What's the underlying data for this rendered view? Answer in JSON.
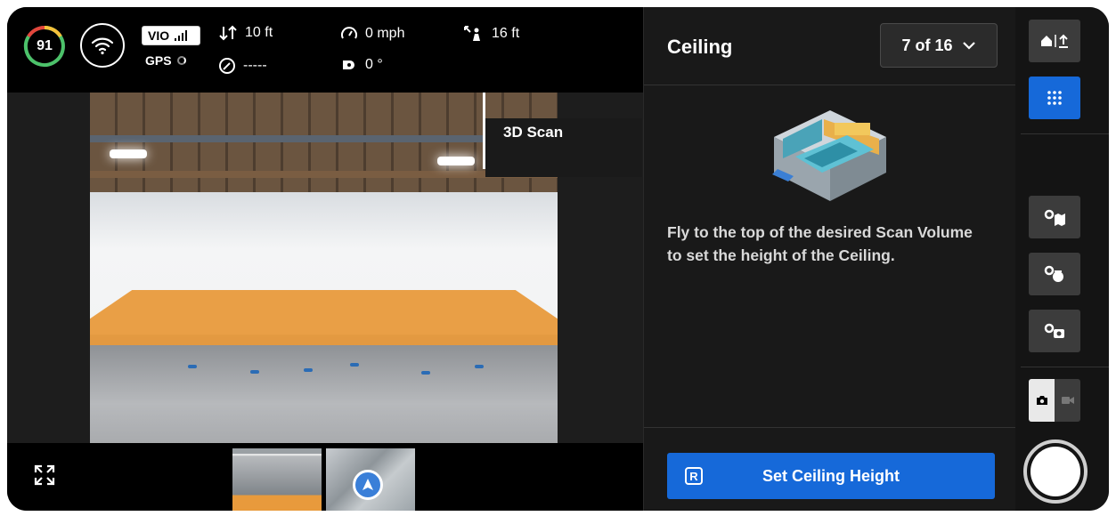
{
  "telemetry": {
    "battery_percent": "91",
    "vio_label": "VIO",
    "gps_label": "GPS",
    "altitude": "10 ft",
    "heading": "-----",
    "speed": "0 mph",
    "gimbal_angle": "0 °",
    "distance": "16 ft"
  },
  "video": {
    "mode_label": "3D Scan"
  },
  "panel": {
    "title": "Ceiling",
    "step": "7 of 16",
    "instruction": "Fly to the top of the desired Scan Volume to set the height of the Ceiling.",
    "action_key": "R",
    "action_label": "Set Ceiling Height"
  },
  "rail": {
    "buttons": [
      {
        "icon": "home-altitude-icon",
        "active": false
      },
      {
        "icon": "grid-menu-icon",
        "active": true
      },
      {
        "icon": "settings-map-icon",
        "active": false
      },
      {
        "icon": "settings-obstacle-icon",
        "active": false
      },
      {
        "icon": "settings-camera-icon",
        "active": false
      }
    ],
    "capture_mode": "photo"
  },
  "colors": {
    "accent": "#1669d9",
    "battery_ring": "#f5c13a",
    "scan_volume": "#e89a3c"
  }
}
